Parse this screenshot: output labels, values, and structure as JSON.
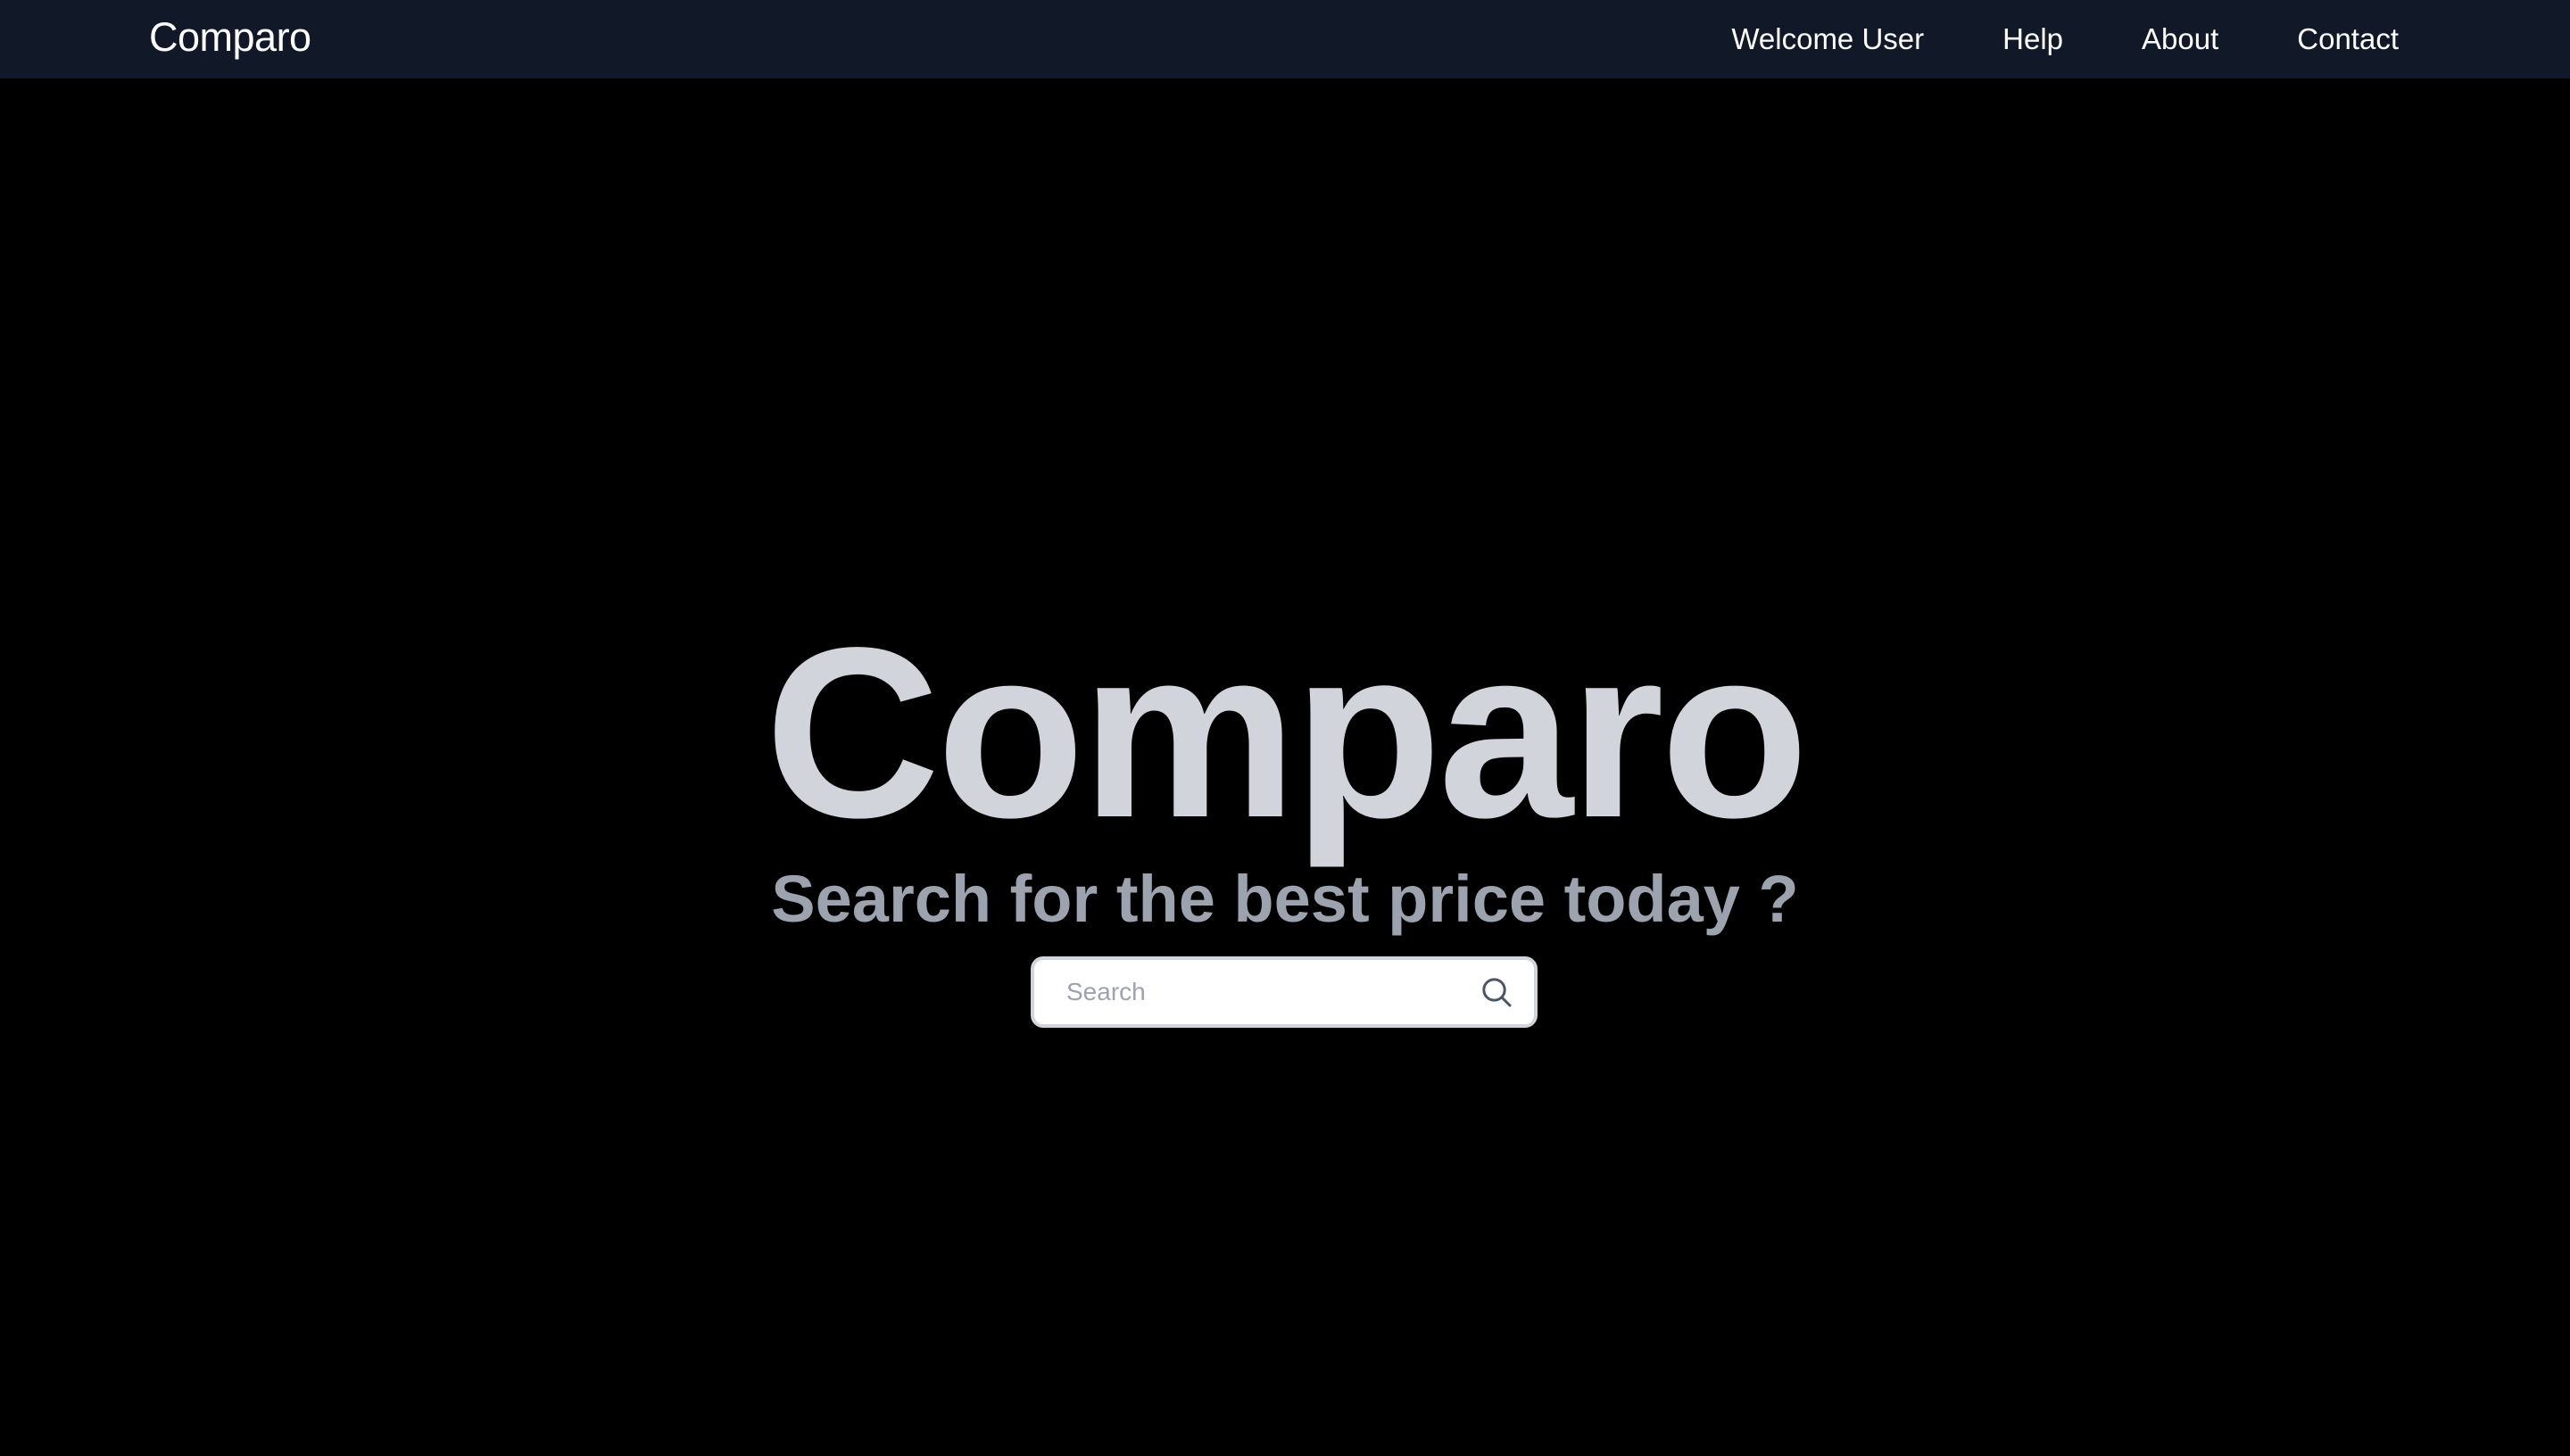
{
  "navbar": {
    "brand": "Comparo",
    "links": [
      "Welcome User",
      "Help",
      "About",
      "Contact"
    ]
  },
  "hero": {
    "title": "Comparo",
    "subtitle": "Search for the best price today ?"
  },
  "search": {
    "placeholder": "Search",
    "value": "",
    "icon": "search-icon"
  },
  "colors": {
    "navbar_bg": "#111827",
    "page_bg": "#000000",
    "title": "#d1d5db",
    "subtitle": "#9ca3af",
    "nav_text": "#ffffff"
  }
}
